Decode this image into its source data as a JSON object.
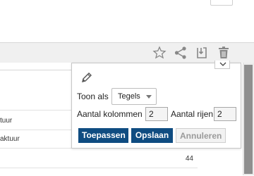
{
  "toolbar": {
    "icons": [
      "star-icon",
      "share-icon",
      "export-icon",
      "trash-icon"
    ]
  },
  "background_table": {
    "cells": [
      "tuur",
      "aktuur"
    ],
    "value": "44"
  },
  "popup": {
    "icon": "pencil-icon",
    "show_as_label": "Toon als",
    "show_as_value": "Tegels",
    "columns_label": "Aantal kolommen",
    "columns_value": "2",
    "rows_label": "Aantal rijen",
    "rows_value": "2",
    "apply_button": "Toepassen",
    "save_button": "Opslaan",
    "cancel_button": "Annuleren"
  },
  "colors": {
    "primary_button": "#0f4c81",
    "toolbar_background": "#f0f0f0"
  }
}
